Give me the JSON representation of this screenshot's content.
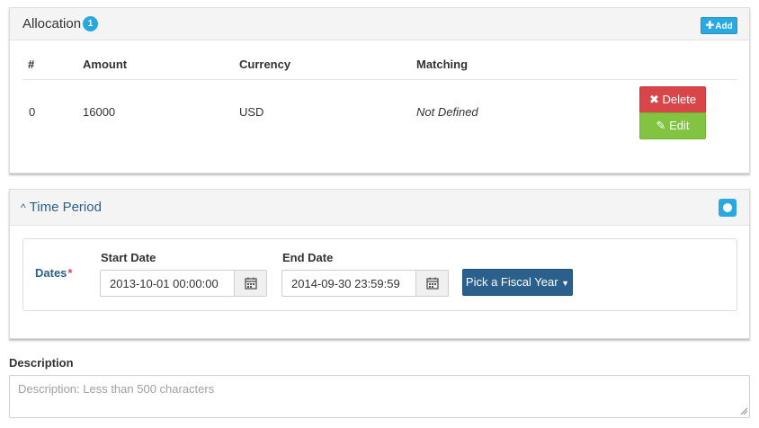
{
  "allocation": {
    "title": "Allocation",
    "count": "1",
    "add_label": "Add",
    "columns": [
      "#",
      "Amount",
      "Currency",
      "Matching"
    ],
    "rows": [
      {
        "index": "0",
        "amount": "16000",
        "currency": "USD",
        "matching": "Not Defined"
      }
    ],
    "delete_label": "Delete",
    "edit_label": "Edit",
    "colors": {
      "badge": "#29a8e0",
      "add": "#2aa9e0",
      "delete": "#d9464a",
      "edit": "#82c341"
    }
  },
  "time_period": {
    "title": "Time Period",
    "dates_label": "Dates",
    "required_mark": "*",
    "start_label": "Start Date",
    "start_value": "2013-10-01 00:00:00",
    "end_label": "End Date",
    "end_value": "2014-09-30 23:59:59",
    "fiscal_label": "Pick a Fiscal Year",
    "colors": {
      "primary": "#2b5f8c",
      "toggle": "#2aa9e0"
    }
  },
  "description": {
    "label": "Description",
    "placeholder": "Description: Less than 500 characters",
    "value": ""
  },
  "icons": {
    "add": "plus-icon",
    "delete": "times-icon",
    "edit": "pencil-icon",
    "calendar": "calendar-icon",
    "collapse": "chevron-up-icon",
    "fiscal": "caret-down-icon",
    "toggle": "circle-toggle-icon"
  }
}
